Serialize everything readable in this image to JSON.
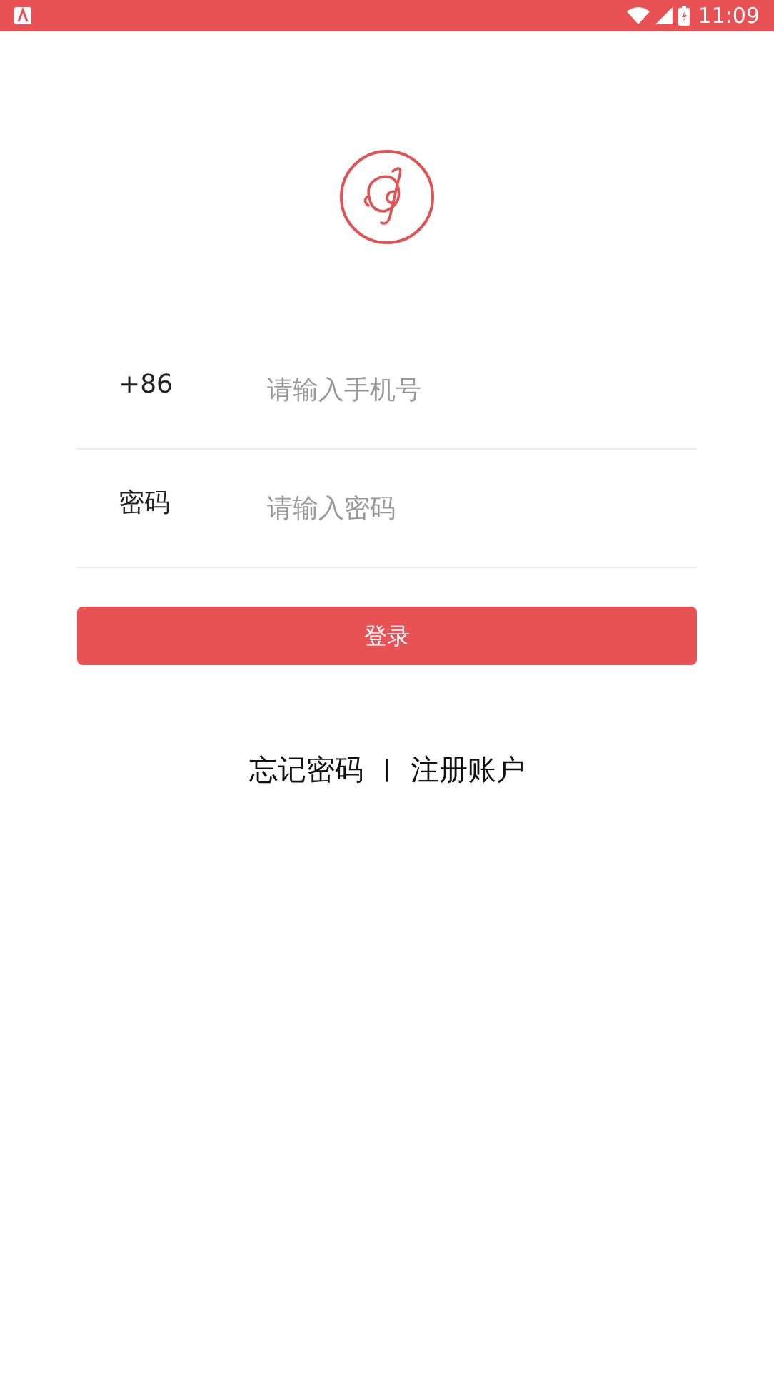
{
  "status_bar": {
    "time": "11:09"
  },
  "form": {
    "fields": [
      {
        "label": "+86",
        "placeholder": "请输入手机号"
      },
      {
        "label": "密码",
        "placeholder": "请输入密码"
      }
    ]
  },
  "login_button": "登录",
  "links": [
    "忘记密码",
    "|",
    "注册账户"
  ]
}
